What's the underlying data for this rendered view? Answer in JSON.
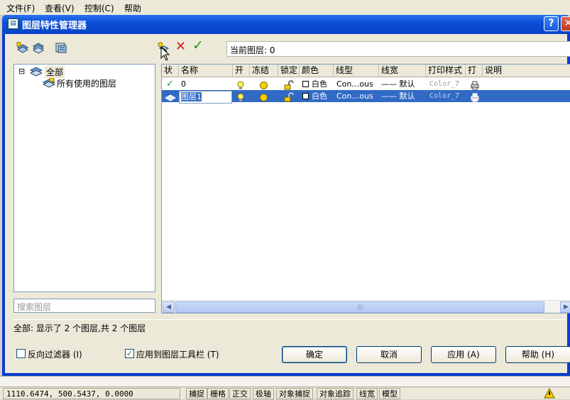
{
  "menu": [
    "文件(F)",
    "查看(V)",
    "控制(C)",
    "帮助"
  ],
  "dialog": {
    "title": "图层特性管理器",
    "help_glyph": "?",
    "close_glyph": "✕"
  },
  "toolbar": {
    "current_layer_label": "当前图层: 0",
    "delete_glyph": "✕",
    "set_current_glyph": "✓"
  },
  "tree": {
    "root": "全部",
    "child": "所有使用的图层",
    "expander": "⊟"
  },
  "search": {
    "placeholder": "搜索图层"
  },
  "grid": {
    "columns": [
      "状",
      "名称",
      "开",
      "冻结",
      "锁定",
      "颜色",
      "线型",
      "线宽",
      "打印样式",
      "打",
      "说明"
    ],
    "rows": [
      {
        "status": "✓",
        "name": "0",
        "color": "白色",
        "linetype": "Con…ous",
        "lineweight": "—— 默认",
        "plotstyle": "Color_7",
        "selected": false
      },
      {
        "status": "",
        "name": "图层1",
        "color": "白色",
        "linetype": "Con…ous",
        "lineweight": "—— 默认",
        "plotstyle": "Color_7",
        "selected": true
      }
    ]
  },
  "scroll": {
    "left": "◀",
    "right": "▶",
    "grip": "|||"
  },
  "summary": "全部: 显示了 2 个图层,共 2 个图层",
  "options": {
    "invert_filter": "反向过滤器 (I)",
    "apply_toolbar": "应用到图层工具栏 (T)",
    "apply_toolbar_checked": true,
    "invert_filter_checked": false
  },
  "buttons": {
    "ok": "确定",
    "cancel": "取消",
    "apply": "应用 (A)",
    "help": "帮助 (H)"
  },
  "statusbar": {
    "coords": "1110.6474, 500.5437, 0.0000",
    "toggles": [
      "捕捉",
      "栅格",
      "正交",
      "极轴",
      "对象捕捉",
      "对象追踪",
      "线宽",
      "模型"
    ]
  }
}
